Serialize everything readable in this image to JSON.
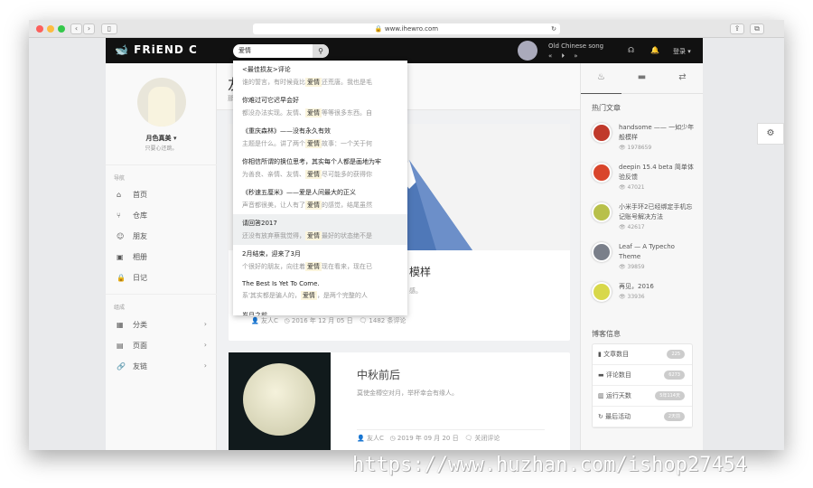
{
  "browser": {
    "url": "www.ihewro.com"
  },
  "header": {
    "logo": "FRiEND C",
    "search_value": "爱情",
    "song": "Old Chinese song",
    "prev": "«",
    "play": "⏵",
    "next": "»",
    "login": "登录"
  },
  "profile": {
    "name": "月色真美",
    "motto": "只要心还跳。"
  },
  "nav": {
    "heading1": "导航",
    "items1": [
      {
        "icon": "⌂",
        "label": "首页"
      },
      {
        "icon": "⑂",
        "label": "仓库"
      },
      {
        "icon": "☺",
        "label": "朋友"
      },
      {
        "icon": "▣",
        "label": "相册"
      },
      {
        "icon": "🔒",
        "label": "日记"
      }
    ],
    "heading2": "组成",
    "items2": [
      {
        "icon": "▦",
        "label": "分类"
      },
      {
        "icon": "▤",
        "label": "页面"
      },
      {
        "icon": "🔗",
        "label": "友链"
      }
    ]
  },
  "page": {
    "title": "友",
    "subtitle": "那"
  },
  "posts": [
    {
      "title_tail": "模样",
      "excerpt_tail": "感。",
      "author": "友人C",
      "date": "2016 年 12 月 05 日",
      "comments": "1482 条评论"
    },
    {
      "title": "中秋前后",
      "excerpt": "莫使金樽空对月，举杯幸会有缘人。",
      "author": "友人C",
      "date": "2019 年 09 月 20 日",
      "comments": "关闭评论"
    }
  ],
  "search_results": [
    {
      "title": "<最佳损友>评论",
      "pre": "谁的誓言，有时候竟比",
      "kw": "爱情",
      "post": "还荒唐。我也是毛"
    },
    {
      "title": "你难过可它迟早会好",
      "pre": "都没办法实现。友情、",
      "kw": "爱情",
      "post": "等等很多东西。自"
    },
    {
      "title": "《重庆森林》——没有永久有效",
      "pre": "主题是什么。讲了两个",
      "kw": "爱情",
      "post": "故事：一个关于何"
    },
    {
      "title": "你相信所谓的换位思考，其实每个人都是画地为牢",
      "pre": "为善良、亲情、友情、",
      "kw": "爱情",
      "post": "尽可能多的获得你"
    },
    {
      "title": "《秒速五厘米》——爱是人间最大的正义",
      "pre": "声音都很美，让人有了",
      "kw": "爱情",
      "post": "的感觉，结尾虽然"
    },
    {
      "title": "请回答2017",
      "pre": "还没有放弃蔡我觉得，",
      "kw": "爱情",
      "post": "最好的状态绝不是"
    },
    {
      "title": "2月结束，迎来了3月",
      "pre": "个很好的朋友，向往着",
      "kw": "爱情",
      "post": "现在看来，现在已"
    },
    {
      "title": "The Best Is Yet To Come.",
      "pre": "系'其实都是骗人的，",
      "kw": "爱情",
      "post": "，是两个完整的人"
    },
    {
      "title": "岁月之前",
      "pre": "",
      "kw": "",
      "post": ""
    }
  ],
  "right": {
    "hot_heading": "热门文章",
    "hot": [
      {
        "title": "handsome —— 一如少年般模样",
        "views": "1978659",
        "color": "#c0392b"
      },
      {
        "title": "deepin 15.4 beta 简单体验反馈",
        "views": "47021",
        "color": "#d9452b"
      },
      {
        "title": "小米手环2已经绑定手机忘记账号解决方法",
        "views": "42617",
        "color": "#b8c04a"
      },
      {
        "title": "Leaf — A Typecho Theme",
        "views": "39859",
        "color": "#7a7f8a"
      },
      {
        "title": "再见，2016",
        "views": "33936",
        "color": "#d8d84a"
      }
    ],
    "info_heading": "博客信息",
    "info": [
      {
        "icon": "▮",
        "label": "文章数目",
        "value": "225"
      },
      {
        "icon": "▬",
        "label": "评论数目",
        "value": "6273"
      },
      {
        "icon": "▥",
        "label": "运行天数",
        "value": "5年114天"
      },
      {
        "icon": "↻",
        "label": "最后活动",
        "value": "2天前"
      }
    ]
  },
  "watermark": "https://www.huzhan.com/ishop27454"
}
